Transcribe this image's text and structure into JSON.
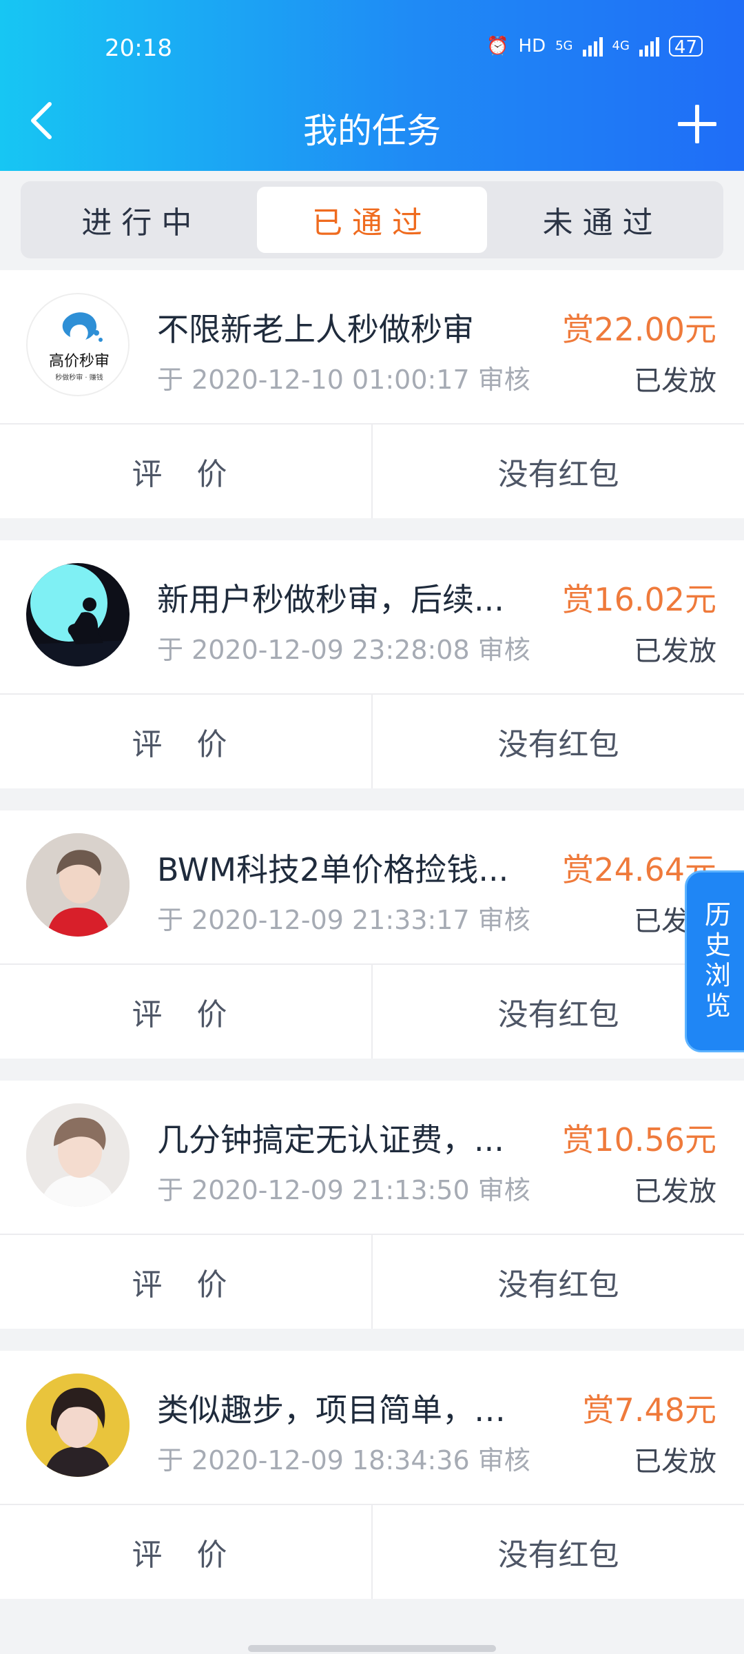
{
  "status_bar": {
    "time": "20:18",
    "network": "HD",
    "signal_1": "5G",
    "signal_2": "4G",
    "battery": "47"
  },
  "header": {
    "title": "我的任务"
  },
  "tabs": [
    {
      "label": "进行中",
      "active": false
    },
    {
      "label": "已通过",
      "active": true
    },
    {
      "label": "未通过",
      "active": false
    }
  ],
  "tasks": [
    {
      "title": "不限新老上人秒做秒审",
      "time": "于 2020-12-10 01:00:17 审核",
      "reward": "赏22.00元",
      "status": "已发放",
      "rate_label": "评 价",
      "redpack_label": "没有红包",
      "avatar_text": "高价秒审",
      "avatar_subtext": "秒做秒审 · 赚钱"
    },
    {
      "title": "新用户秒做秒审，后续...",
      "time": "于 2020-12-09 23:28:08 审核",
      "reward": "赏16.02元",
      "status": "已发放",
      "rate_label": "评 价",
      "redpack_label": "没有红包"
    },
    {
      "title": "BWM科技2单价格捡钱...",
      "time": "于 2020-12-09 21:33:17 审核",
      "reward": "赏24.64元",
      "status": "已发放",
      "rate_label": "评 价",
      "redpack_label": "没有红包"
    },
    {
      "title": "几分钟搞定无认证费，...",
      "time": "于 2020-12-09 21:13:50 审核",
      "reward": "赏10.56元",
      "status": "已发放",
      "rate_label": "评 价",
      "redpack_label": "没有红包"
    },
    {
      "title": "类似趣步，项目简单，提...",
      "time": "于 2020-12-09 18:34:36 审核",
      "reward": "赏7.48元",
      "status": "已发放",
      "rate_label": "评 价",
      "redpack_label": "没有红包"
    }
  ],
  "history_button": {
    "label": "历史浏览"
  },
  "colors": {
    "header_start": "#17c6f3",
    "header_end": "#1f6df7",
    "accent_orange": "#ef6b1f",
    "reward": "#ef7a3b",
    "history_bg": "#1f86f5"
  }
}
